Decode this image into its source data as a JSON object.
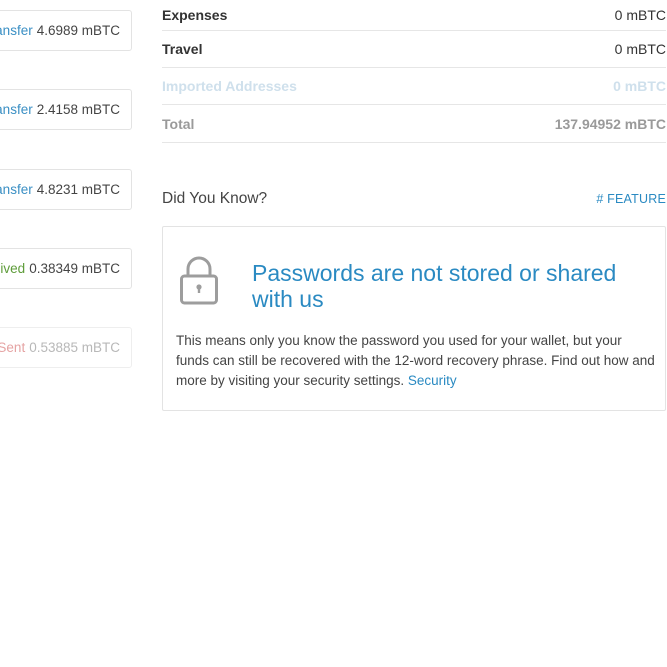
{
  "transactions": [
    {
      "type": "ansfer",
      "kind": "transfer",
      "amount": "4.6989 mBTC"
    },
    {
      "type": "ansfer",
      "kind": "transfer",
      "amount": "2.4158 mBTC"
    },
    {
      "type": "ansfer",
      "kind": "transfer",
      "amount": "4.8231 mBTC"
    },
    {
      "type": "eived",
      "kind": "received",
      "amount": "0.38349 mBTC"
    },
    {
      "type": "Sent",
      "kind": "sent",
      "amount": "0.53885 mBTC"
    }
  ],
  "balances": [
    {
      "label": "Expenses",
      "value": "0 mBTC"
    },
    {
      "label": "Travel",
      "value": "0 mBTC"
    },
    {
      "label": "Imported Addresses",
      "value": "0 mBTC"
    },
    {
      "label": "Total",
      "value": "137.94952 mBTC"
    }
  ],
  "did_you_know": {
    "title": "Did You Know?",
    "tag": "# FEATURE",
    "icon": "lock-icon",
    "heading": "Passwords are not stored or shared with us",
    "body": "This means only you know the password you used for your wallet, but your funds can still be recovered with the 12-word recovery phrase. Find out how and more by visiting your security settings.",
    "link_label": "Security"
  },
  "colors": {
    "accent": "#2a8ac2",
    "transfer": "#3a8fc4",
    "received": "#5e9c3a",
    "sent": "#e5a3a3"
  }
}
